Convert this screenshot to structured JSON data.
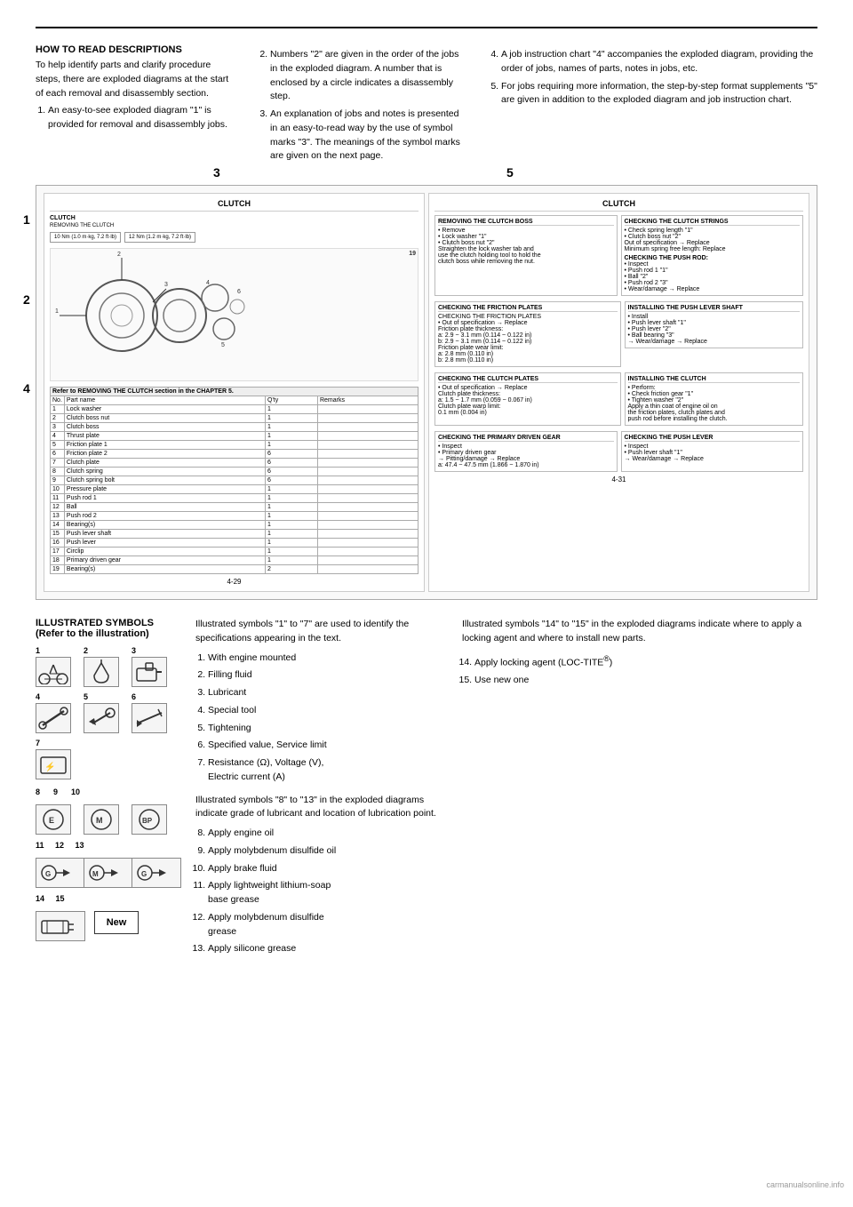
{
  "page": {
    "top_border": true
  },
  "how_to_read": {
    "title": "HOW TO READ DESCRIPTIONS",
    "intro": "To help identify parts and clarify procedure steps, there are exploded diagrams at the start of each removal and disassembly section.",
    "point1": "An easy-to-see exploded diagram \"1\" is provided for removal and disassembly jobs.",
    "point2": "Numbers \"2\" are given in the order of the jobs in the exploded diagram. A number that is enclosed by a circle indicates a disassembly step.",
    "point3": "An explanation of jobs and notes is presented in an easy-to-read way by the use of symbol marks \"3\". The meanings of the symbol marks are given on the next page.",
    "point4": "A job instruction chart \"4\" accompanies the exploded diagram, providing the order of jobs, names of parts, notes in jobs, etc.",
    "point5": "For jobs requiring more information, the step-by-step format supplements \"5\" are given in addition to the exploded diagram and job instruction chart."
  },
  "diagram_numbers": {
    "three": "3",
    "five": "5",
    "one": "1",
    "two": "2",
    "four": "4"
  },
  "diagram_labels": {
    "clutch_left": "CLUTCH",
    "clutch_right": "CLUTCH",
    "removing_clutch_boss": "REMOVING THE CLUTCH BOSS",
    "checking_clutch_strings": "CHECKING THE CLUTCH STRINGS",
    "checking_friction_plates": "CHECKING THE FRICTION PLATES",
    "checking_clutch_plates": "CHECKING THE CLUTCH PLATES",
    "checking_primary_driven": "CHECKING THE PRIMARY DRIVEN GEAR",
    "checking_push_lever": "CHECKING THE PUSH LEVER",
    "checking_push_rod": "CHECKING THE PUSH ROD",
    "installing_push_lever": "INSTALLING THE PUSH LEVER SHAFT",
    "installing_clutch": "INSTALLING THE CLUTCH",
    "page_left": "4-29",
    "page_right": "4-31"
  },
  "illustrated_symbols": {
    "title": "ILLUSTRATED SYMBOLS (Refer to the illustration)",
    "intro": "Illustrated symbols \"1\" to \"7\" are used to identify the specifications appearing in the text.",
    "symbols_1_7": [
      {
        "num": "1",
        "label": "With engine mounted",
        "icon": "motorcycle"
      },
      {
        "num": "2",
        "label": "Filling fluid",
        "icon": "fluid"
      },
      {
        "num": "3",
        "label": "Lubricant",
        "icon": "lubricant"
      },
      {
        "num": "4",
        "label": "Special tool",
        "icon": "tool"
      },
      {
        "num": "5",
        "label": "Tightening",
        "icon": "tighten"
      },
      {
        "num": "6",
        "label": "Specified value, Service limit",
        "icon": "spec"
      },
      {
        "num": "7",
        "label": "Resistance (Ω), Voltage (V), Electric current (A)",
        "icon": "electric"
      }
    ],
    "intro_8_13": "Illustrated symbols \"8\" to \"13\" in the exploded diagrams indicate grade of lubricant and location of lubrication point.",
    "symbols_8_13": [
      {
        "num": "8",
        "label": "Apply engine oil",
        "icon": "E"
      },
      {
        "num": "9",
        "label": "Apply molybdenum disulfide oil",
        "icon": "M"
      },
      {
        "num": "10",
        "label": "Apply brake fluid",
        "icon": "BP"
      },
      {
        "num": "11",
        "label": "Apply lightweight lithium-soap base grease",
        "icon": "G"
      },
      {
        "num": "12",
        "label": "Apply molybdenum disulfide grease",
        "icon": "M"
      },
      {
        "num": "13",
        "label": "Apply silicone grease",
        "icon": "G"
      }
    ],
    "intro_14_15": "Illustrated symbols \"14\" to \"15\" in the exploded diagrams indicate where to apply a locking agent and where to install new parts.",
    "symbol_14": {
      "num": "14",
      "label": "Apply locking agent (LOC-TITE®)",
      "icon": "lock"
    },
    "symbol_15": {
      "num": "15",
      "label": "Use new one",
      "icon": "New"
    }
  }
}
